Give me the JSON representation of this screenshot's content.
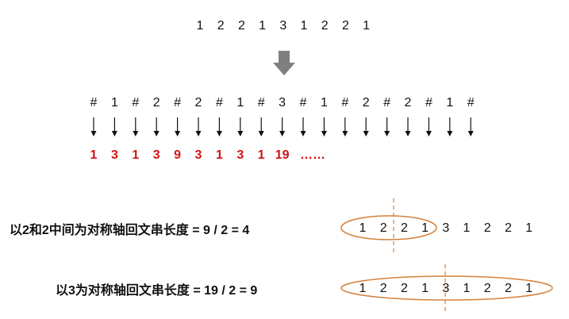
{
  "top_sequence": [
    "1",
    "2",
    "2",
    "1",
    "3",
    "1",
    "2",
    "2",
    "1"
  ],
  "transformed_sequence": [
    "#",
    "1",
    "#",
    "2",
    "#",
    "2",
    "#",
    "1",
    "#",
    "3",
    "#",
    "1",
    "#",
    "2",
    "#",
    "2",
    "#",
    "1",
    "#"
  ],
  "radius_values": [
    "1",
    "3",
    "1",
    "3",
    "9",
    "3",
    "1",
    "3",
    "1",
    "19"
  ],
  "ellipsis": "……",
  "example1": {
    "text": "以2和2中间为对称轴回文串长度 = 9 / 2 = 4",
    "sequence": [
      "1",
      "2",
      "2",
      "1",
      "3",
      "1",
      "2",
      "2",
      "1"
    ]
  },
  "example2": {
    "text": "以3为对称轴回文串长度 = 19 / 2 = 9",
    "sequence": [
      "1",
      "2",
      "2",
      "1",
      "3",
      "1",
      "2",
      "2",
      "1"
    ]
  },
  "colors": {
    "highlight": "#d21414",
    "ellipse": "#d4803a",
    "arrow": "#7f7f7f"
  }
}
